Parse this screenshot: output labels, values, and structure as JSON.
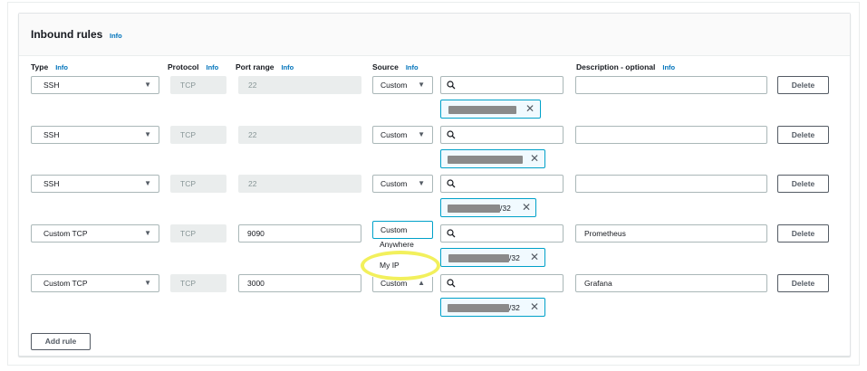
{
  "panel": {
    "title": "Inbound rules",
    "info_label": "Info"
  },
  "columns": {
    "type": "Type",
    "protocol": "Protocol",
    "port_range": "Port range",
    "source": "Source",
    "description": "Description - optional",
    "info_label": "Info"
  },
  "rows": [
    {
      "type": "SSH",
      "protocol": "TCP",
      "port": "22",
      "source": "Custom",
      "source_token_suffix": "",
      "description": "",
      "delete_label": "Delete"
    },
    {
      "type": "SSH",
      "protocol": "TCP",
      "port": "22",
      "source": "Custom",
      "source_token_suffix": "",
      "description": "",
      "delete_label": "Delete"
    },
    {
      "type": "SSH",
      "protocol": "TCP",
      "port": "22",
      "source": "Custom",
      "source_token_suffix": "/32",
      "description": "",
      "delete_label": "Delete"
    },
    {
      "type": "Custom TCP",
      "protocol": "TCP",
      "port": "9090",
      "source": "Custom",
      "source_token_suffix": "/32",
      "description": "Prometheus",
      "delete_label": "Delete"
    },
    {
      "type": "Custom TCP",
      "protocol": "TCP",
      "port": "3000",
      "source": "Custom",
      "source_token_suffix": "/32",
      "description": "Grafana",
      "delete_label": "Delete"
    }
  ],
  "source_dropdown": {
    "options": [
      "Anywhere",
      "My IP"
    ],
    "visible_partial": "Anywhere"
  },
  "add_rule_label": "Add rule",
  "icons": {
    "search": "search-icon",
    "remove": "close-icon",
    "caret": "caret-down-icon"
  },
  "colors": {
    "link": "#0073bb",
    "token_border": "#00a1c9",
    "highlight": "#f2f05c"
  }
}
